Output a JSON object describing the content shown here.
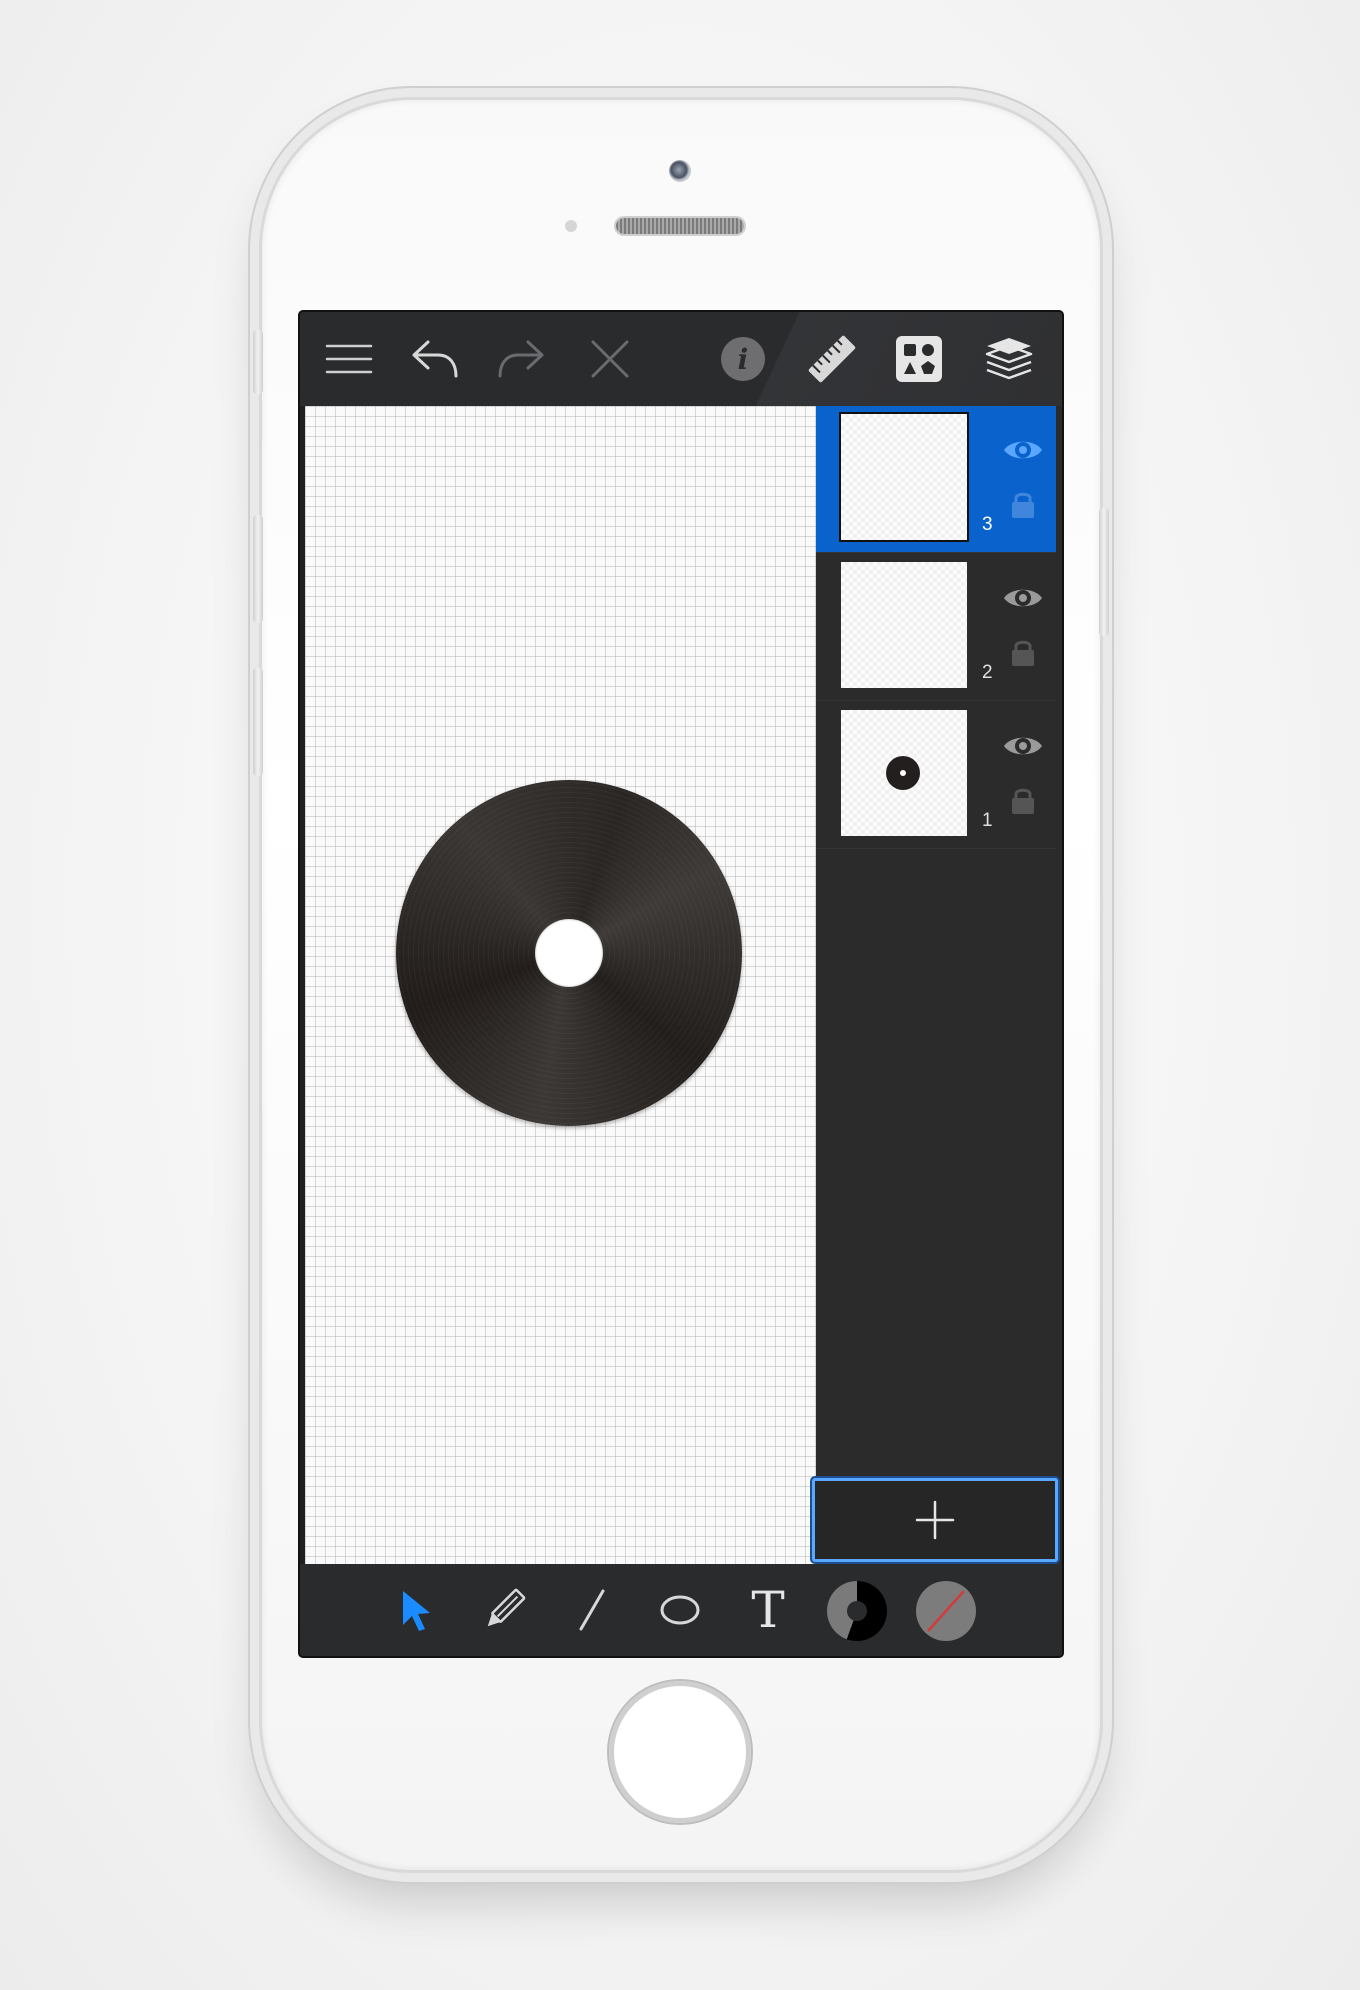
{
  "toolbar": {
    "menu_icon": "hamburger-menu-icon",
    "undo_icon": "undo-arrow-icon",
    "redo_icon": "redo-arrow-icon",
    "delete_icon": "close-x-icon",
    "info_icon": "info-icon",
    "info_glyph": "i",
    "ruler_icon": "ruler-icon",
    "shapes_icon": "shapes-library-icon",
    "layers_icon": "layers-icon"
  },
  "layers": [
    {
      "number": "3",
      "selected": true,
      "visible": true,
      "locked": false
    },
    {
      "number": "2",
      "selected": false,
      "visible": true,
      "locked": false
    },
    {
      "number": "1",
      "selected": false,
      "visible": true,
      "locked": false
    }
  ],
  "add_layer_icon": "plus-icon",
  "tools": {
    "select_icon": "select-arrow-icon",
    "pencil_icon": "pencil-icon",
    "line_icon": "line-icon",
    "ellipse_icon": "ellipse-icon",
    "text_glyph": "T"
  },
  "colors": {
    "accent": "#0a63cc",
    "select_active": "#1a8cff",
    "stroke_color": "#000000",
    "fill_none_slash": "#d23b3b",
    "disc": "#2a2624"
  }
}
